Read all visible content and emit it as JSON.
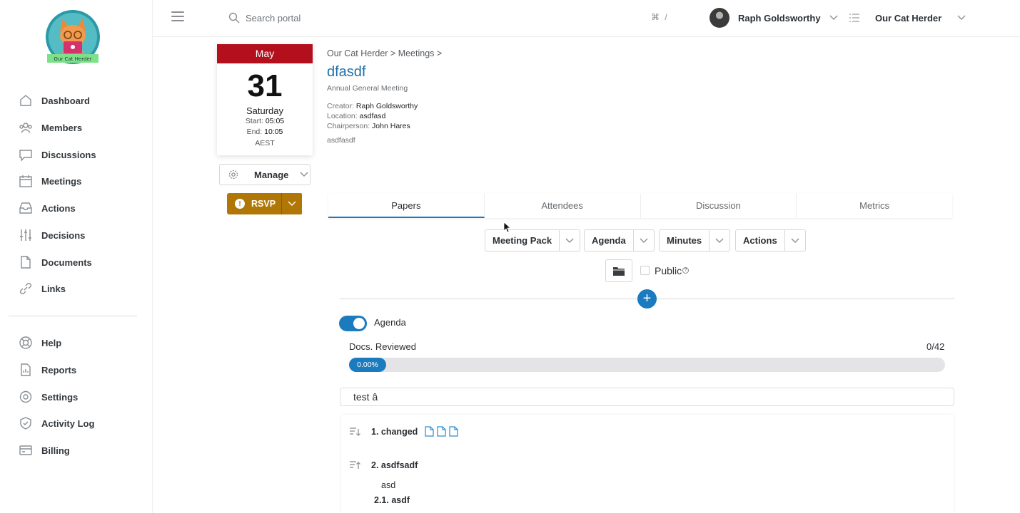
{
  "sidebar": {
    "logo_text": "Our Cat Herder",
    "items": [
      {
        "label": "Dashboard",
        "icon": "home-icon"
      },
      {
        "label": "Members",
        "icon": "users-icon"
      },
      {
        "label": "Discussions",
        "icon": "chat-icon"
      },
      {
        "label": "Meetings",
        "icon": "calendar-icon"
      },
      {
        "label": "Actions",
        "icon": "inbox-icon"
      },
      {
        "label": "Decisions",
        "icon": "sliders-icon"
      },
      {
        "label": "Documents",
        "icon": "document-icon"
      },
      {
        "label": "Links",
        "icon": "link-icon"
      }
    ],
    "bottom_items": [
      {
        "label": "Help",
        "icon": "lifebuoy-icon"
      },
      {
        "label": "Reports",
        "icon": "report-icon"
      },
      {
        "label": "Settings",
        "icon": "gear-icon"
      },
      {
        "label": "Activity Log",
        "icon": "shield-icon"
      },
      {
        "label": "Billing",
        "icon": "credit-card-icon"
      }
    ]
  },
  "topbar": {
    "search_placeholder": "Search portal",
    "shortcut": "⌘ /",
    "user_name": "Raph Goldsworthy",
    "org_name": "Our Cat Herder"
  },
  "meeting": {
    "month": "May",
    "day": "31",
    "weekday": "Saturday",
    "start_label": "Start:",
    "start": "05:05",
    "end_label": "End:",
    "end": "10:05",
    "timezone": "AEST",
    "manage_label": "Manage",
    "rsvp_label": "RSVP",
    "breadcrumb": "Our Cat Herder > Meetings >",
    "title": "dfasdf",
    "type": "Annual General Meeting",
    "creator_label": "Creator:",
    "creator": "Raph Goldsworthy",
    "location_label": "Location:",
    "location": "asdfasd",
    "chair_label": "Chairperson:",
    "chair": "John Hares",
    "description": "asdfasdf"
  },
  "tabs": [
    "Papers",
    "Attendees",
    "Discussion",
    "Metrics"
  ],
  "papers": {
    "buttons": [
      "Meeting Pack",
      "Agenda",
      "Minutes",
      "Actions"
    ],
    "public_label": "Public",
    "agenda_toggle_label": "Agenda",
    "docs_reviewed_label": "Docs. Reviewed",
    "docs_reviewed_count": "0/42",
    "progress_text": "0.00%",
    "progress_value": 0,
    "section_title": "test â",
    "items": [
      {
        "label": "1. changed"
      },
      {
        "label": "2. asdfsadf"
      }
    ],
    "sub_note": "asd",
    "sub_item": "2.1. asdf"
  },
  "colors": {
    "accent": "#1b7bbf",
    "month_red": "#b30f1d",
    "rsvp": "#b07707"
  }
}
